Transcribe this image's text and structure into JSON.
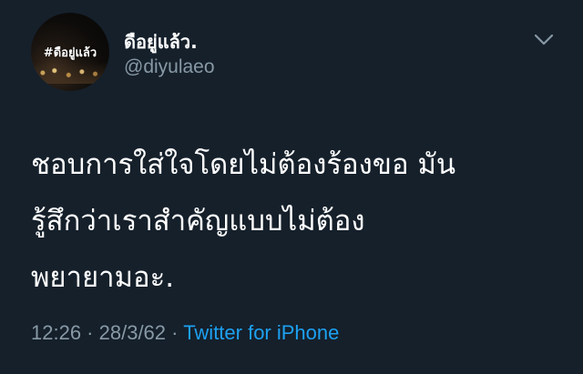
{
  "author": {
    "avatar_label": "#ดือยู่แล้ว",
    "display_name": "ดือยู่แล้ว.",
    "handle": "@diyulaeo"
  },
  "tweet": {
    "lines": [
      "ชอบการใส่ใจโดยไม่ต้องร้องขอ มัน",
      "รู้สึกว่าเราสำคัญแบบไม่ต้อง",
      "พยายามอะ."
    ]
  },
  "meta": {
    "time": "12:26",
    "separator": " · ",
    "date": "28/3/62",
    "source": "Twitter for iPhone"
  },
  "icons": {
    "menu": "chevron-down-icon"
  },
  "colors": {
    "background": "#15202b",
    "text": "#ffffff",
    "secondary": "#8899a6",
    "link": "#1da1f2"
  }
}
